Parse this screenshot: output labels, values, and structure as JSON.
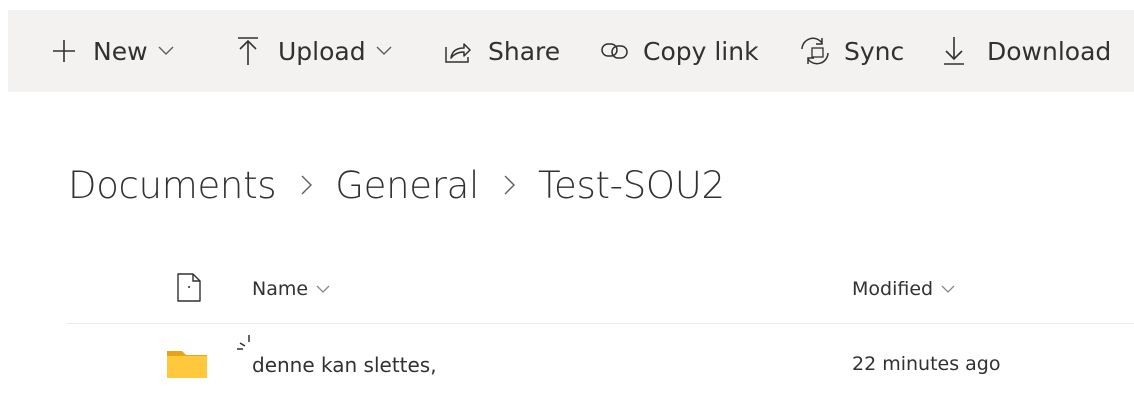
{
  "toolbar": {
    "new_label": "New",
    "upload_label": "Upload",
    "share_label": "Share",
    "copy_link_label": "Copy link",
    "sync_label": "Sync",
    "download_label": "Download"
  },
  "breadcrumb": [
    "Documents",
    "General",
    "Test-SOU2"
  ],
  "columns": {
    "name": "Name",
    "modified": "Modified"
  },
  "rows": [
    {
      "name": "denne kan slettes,",
      "modified": "22 minutes ago",
      "icon": "folder-icon",
      "status_icon": "sync-spinner-icon"
    }
  ],
  "colors": {
    "toolbar_bg": "#f3f2f1",
    "text": "#323130",
    "folder": "#ffc83d",
    "divider": "#edebe9"
  }
}
